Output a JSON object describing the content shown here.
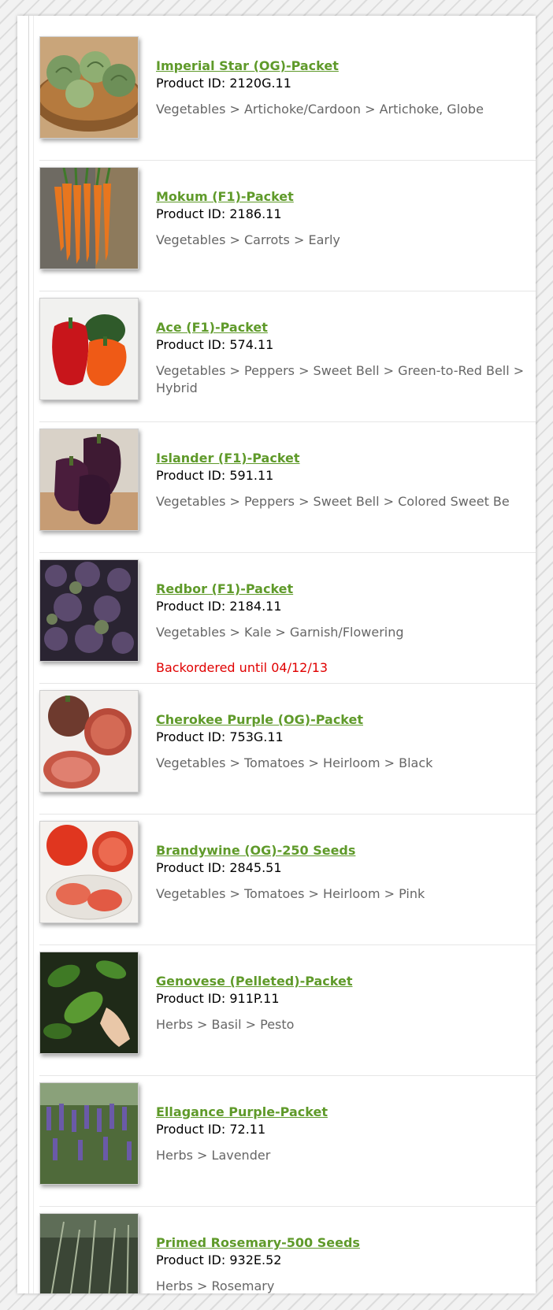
{
  "products": [
    {
      "name": "Imperial Star (OG)-Packet",
      "product_id": "Product ID: 2120G.11",
      "category": "Vegetables > Artichoke/Cardoon > Artichoke, Globe",
      "status": "",
      "image": "artichoke-image"
    },
    {
      "name": "Mokum (F1)-Packet",
      "product_id": "Product ID: 2186.11",
      "category": "Vegetables > Carrots > Early",
      "status": "",
      "image": "carrot-image"
    },
    {
      "name": "Ace (F1)-Packet",
      "product_id": "Product ID: 574.11",
      "category": "Vegetables > Peppers > Sweet Bell > Green-to-Red Bell > Hybrid",
      "status": "",
      "image": "pepper-image"
    },
    {
      "name": "Islander (F1)-Packet",
      "product_id": "Product ID: 591.11",
      "category": "Vegetables > Peppers > Sweet Bell > Colored Sweet Be",
      "status": "",
      "image": "purple-pepper-image"
    },
    {
      "name": "Redbor (F1)-Packet",
      "product_id": "Product ID: 2184.11",
      "category": "Vegetables > Kale > Garnish/Flowering",
      "status": "Backordered until 04/12/13",
      "image": "kale-image"
    },
    {
      "name": "Cherokee Purple (OG)-Packet",
      "product_id": "Product ID: 753G.11",
      "category": "Vegetables > Tomatoes > Heirloom > Black",
      "status": "",
      "image": "cherokee-tomato-image"
    },
    {
      "name": "Brandywine (OG)-250 Seeds",
      "product_id": "Product ID: 2845.51",
      "category": "Vegetables > Tomatoes > Heirloom > Pink",
      "status": "",
      "image": "brandywine-tomato-image"
    },
    {
      "name": "Genovese (Pelleted)-Packet",
      "product_id": "Product ID: 911P.11",
      "category": "Herbs > Basil > Pesto",
      "status": "",
      "image": "basil-image"
    },
    {
      "name": "Ellagance Purple-Packet",
      "product_id": "Product ID: 72.11",
      "category": "Herbs > Lavender",
      "status": "",
      "image": "lavender-image"
    },
    {
      "name": "Primed Rosemary-500 Seeds",
      "product_id": "Product ID: 932E.52",
      "category": "Herbs > Rosemary",
      "status": "",
      "image": "rosemary-image"
    }
  ],
  "colors": {
    "link": "#5f9a2a",
    "backorder": "#e00000",
    "category": "#666666"
  }
}
